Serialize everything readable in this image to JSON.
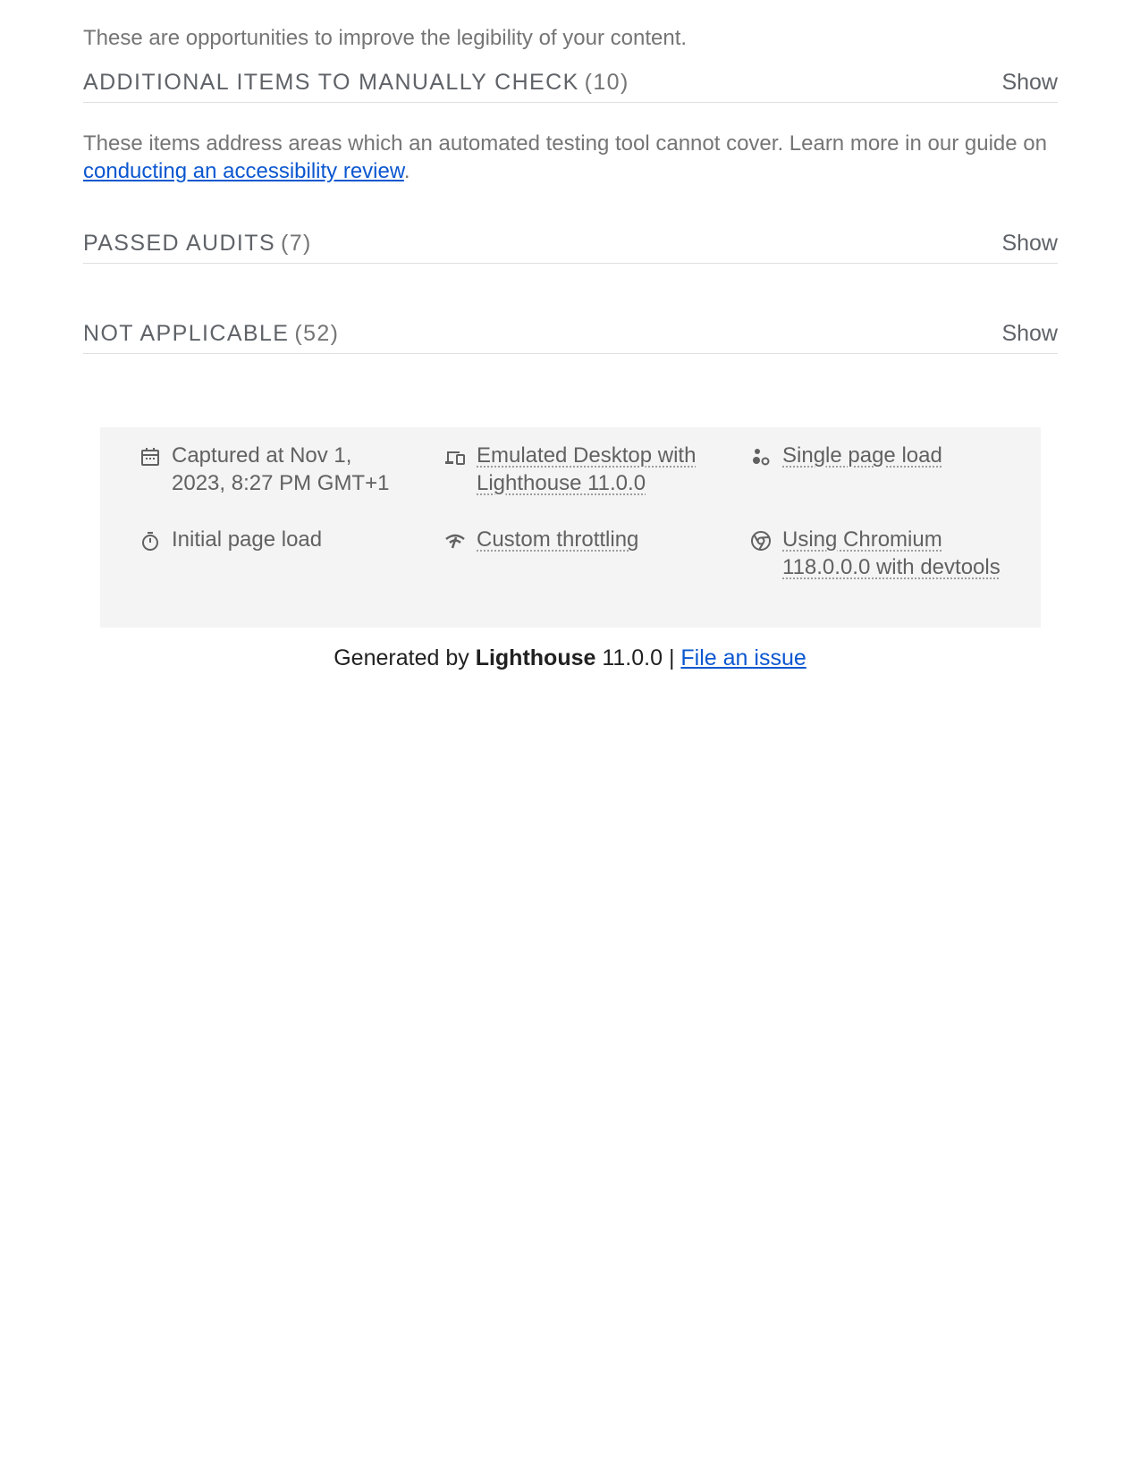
{
  "intro_text": "These are opportunities to improve the legibility of your content.",
  "groups": {
    "manual": {
      "title": "ADDITIONAL ITEMS TO MANUALLY CHECK",
      "count": "(10)",
      "show_label": "Show",
      "desc_before": "These items address areas which an automated testing tool cannot cover. Learn more in our guide on",
      "desc_link": "conducting an accessibility review",
      "desc_after": "."
    },
    "passed": {
      "title": "PASSED AUDITS",
      "count": "(7)",
      "show_label": "Show"
    },
    "not_applicable": {
      "title": "NOT APPLICABLE",
      "count": "(52)",
      "show_label": "Show"
    }
  },
  "env": {
    "captured": {
      "icon": "calendar-icon",
      "text": "Captured at Nov 1, 2023, 8:27 PM GMT+1"
    },
    "device": {
      "icon": "devices-icon",
      "text": "Emulated Desktop with Lighthouse 11.0.0"
    },
    "session": {
      "icon": "single-page-load-icon",
      "text": "Single page load"
    },
    "load": {
      "icon": "stopwatch-icon",
      "text": "Initial page load"
    },
    "throttling": {
      "icon": "network-throttle-icon",
      "text": "Custom throttling"
    },
    "browser": {
      "icon": "chrome-icon",
      "text": "Using Chromium 118.0.0.0 with devtools"
    }
  },
  "footer": {
    "generated_by": "Generated by",
    "product": "Lighthouse",
    "version": "11.0.0 |",
    "issue_link": "File an issue"
  },
  "colors": {
    "text_muted": "#757575",
    "header_text": "#5f6368",
    "link": "#0b57d0",
    "env_bg": "#f4f4f4"
  }
}
